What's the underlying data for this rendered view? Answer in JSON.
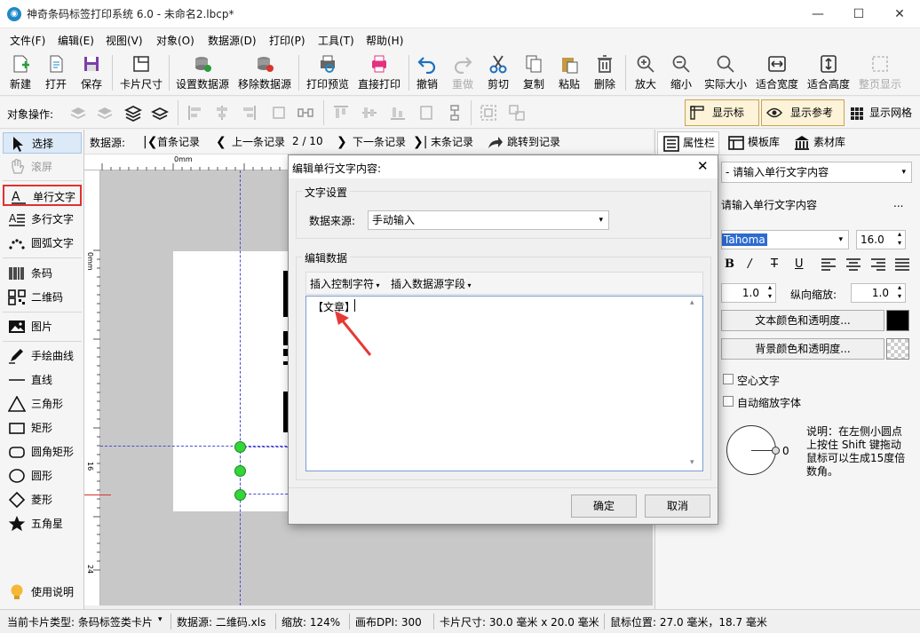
{
  "window": {
    "title": "神奇条码标签打印系统 6.0 - 未命名2.lbcp*",
    "min_icon": "minimize-icon",
    "max_icon": "maximize-icon",
    "close_icon": "close-icon"
  },
  "menu": [
    "文件(F)",
    "编辑(E)",
    "视图(V)",
    "对象(O)",
    "数据源(D)",
    "打印(P)",
    "工具(T)",
    "帮助(H)"
  ],
  "toolbar": [
    "新建",
    "打开",
    "保存",
    "卡片尺寸",
    "设置数据源",
    "移除数据源",
    "打印预览",
    "直接打印",
    "撤销",
    "重做",
    "剪切",
    "复制",
    "粘贴",
    "删除",
    "放大",
    "缩小",
    "实际大小",
    "适合宽度",
    "适合高度",
    "整页显示"
  ],
  "object_bar": {
    "label": "对象操作:",
    "show_ruler": "显示标尺",
    "show_guides": "显示参考线",
    "show_grid": "显示网格"
  },
  "tools": [
    "选择",
    "滚屏",
    "单行文字",
    "多行文字",
    "圆弧文字",
    "条码",
    "二维码",
    "图片",
    "手绘曲线",
    "直线",
    "三角形",
    "矩形",
    "圆角矩形",
    "圆形",
    "菱形",
    "五角星",
    "使用说明"
  ],
  "record_nav": {
    "label": "数据源:",
    "first": "首条记录",
    "prev": "上一条记录",
    "position": "2 / 10",
    "next": "下一条记录",
    "last": "末条记录",
    "jump": "跳转到记录"
  },
  "ruler": {
    "h0": "0mm",
    "v0": "0mm",
    "v16": "16",
    "v24": "24"
  },
  "right_tabs": [
    "属性栏",
    "模板库",
    "素材库"
  ],
  "props": {
    "content_select": "- 请输入单行文字内容",
    "content_field": "请输入单行文字内容",
    "content_more": "...",
    "font": "Tahoma",
    "font_size": "16.0",
    "spacing_value": "1.0",
    "vscale_label": "纵向缩放:",
    "vscale_value": "1.0",
    "text_color_btn": "文本颜色和透明度...",
    "bg_color_btn": "背景颜色和透明度...",
    "text_color": "#000000",
    "hollow_text": "空心文字",
    "auto_shrink": "自动缩放字体",
    "rotation": "0",
    "hint": "说明：在左侧小圆点上按住 Shift 键拖动鼠标可以生成15度倍数角。"
  },
  "dialog": {
    "title": "编辑单行文字内容:",
    "text_settings_group": "文字设置",
    "source_label": "数据来源:",
    "source_value": "手动输入",
    "edit_group": "编辑数据",
    "insert_ctrl": "插入控制字符",
    "insert_field": "插入数据源字段",
    "content": "【文章】",
    "ok": "确定",
    "cancel": "取消"
  },
  "status": {
    "card_type": "当前卡片类型: 条码标签类卡片",
    "source": "数据源: 二维码.xls",
    "zoom": "缩放: 124%",
    "dpi": "画布DPI: 300",
    "card_size": "卡片尺寸: 30.0 毫米 x 20.0 毫米",
    "mouse": "鼠标位置: 27.0 毫米，18.7 毫米"
  }
}
